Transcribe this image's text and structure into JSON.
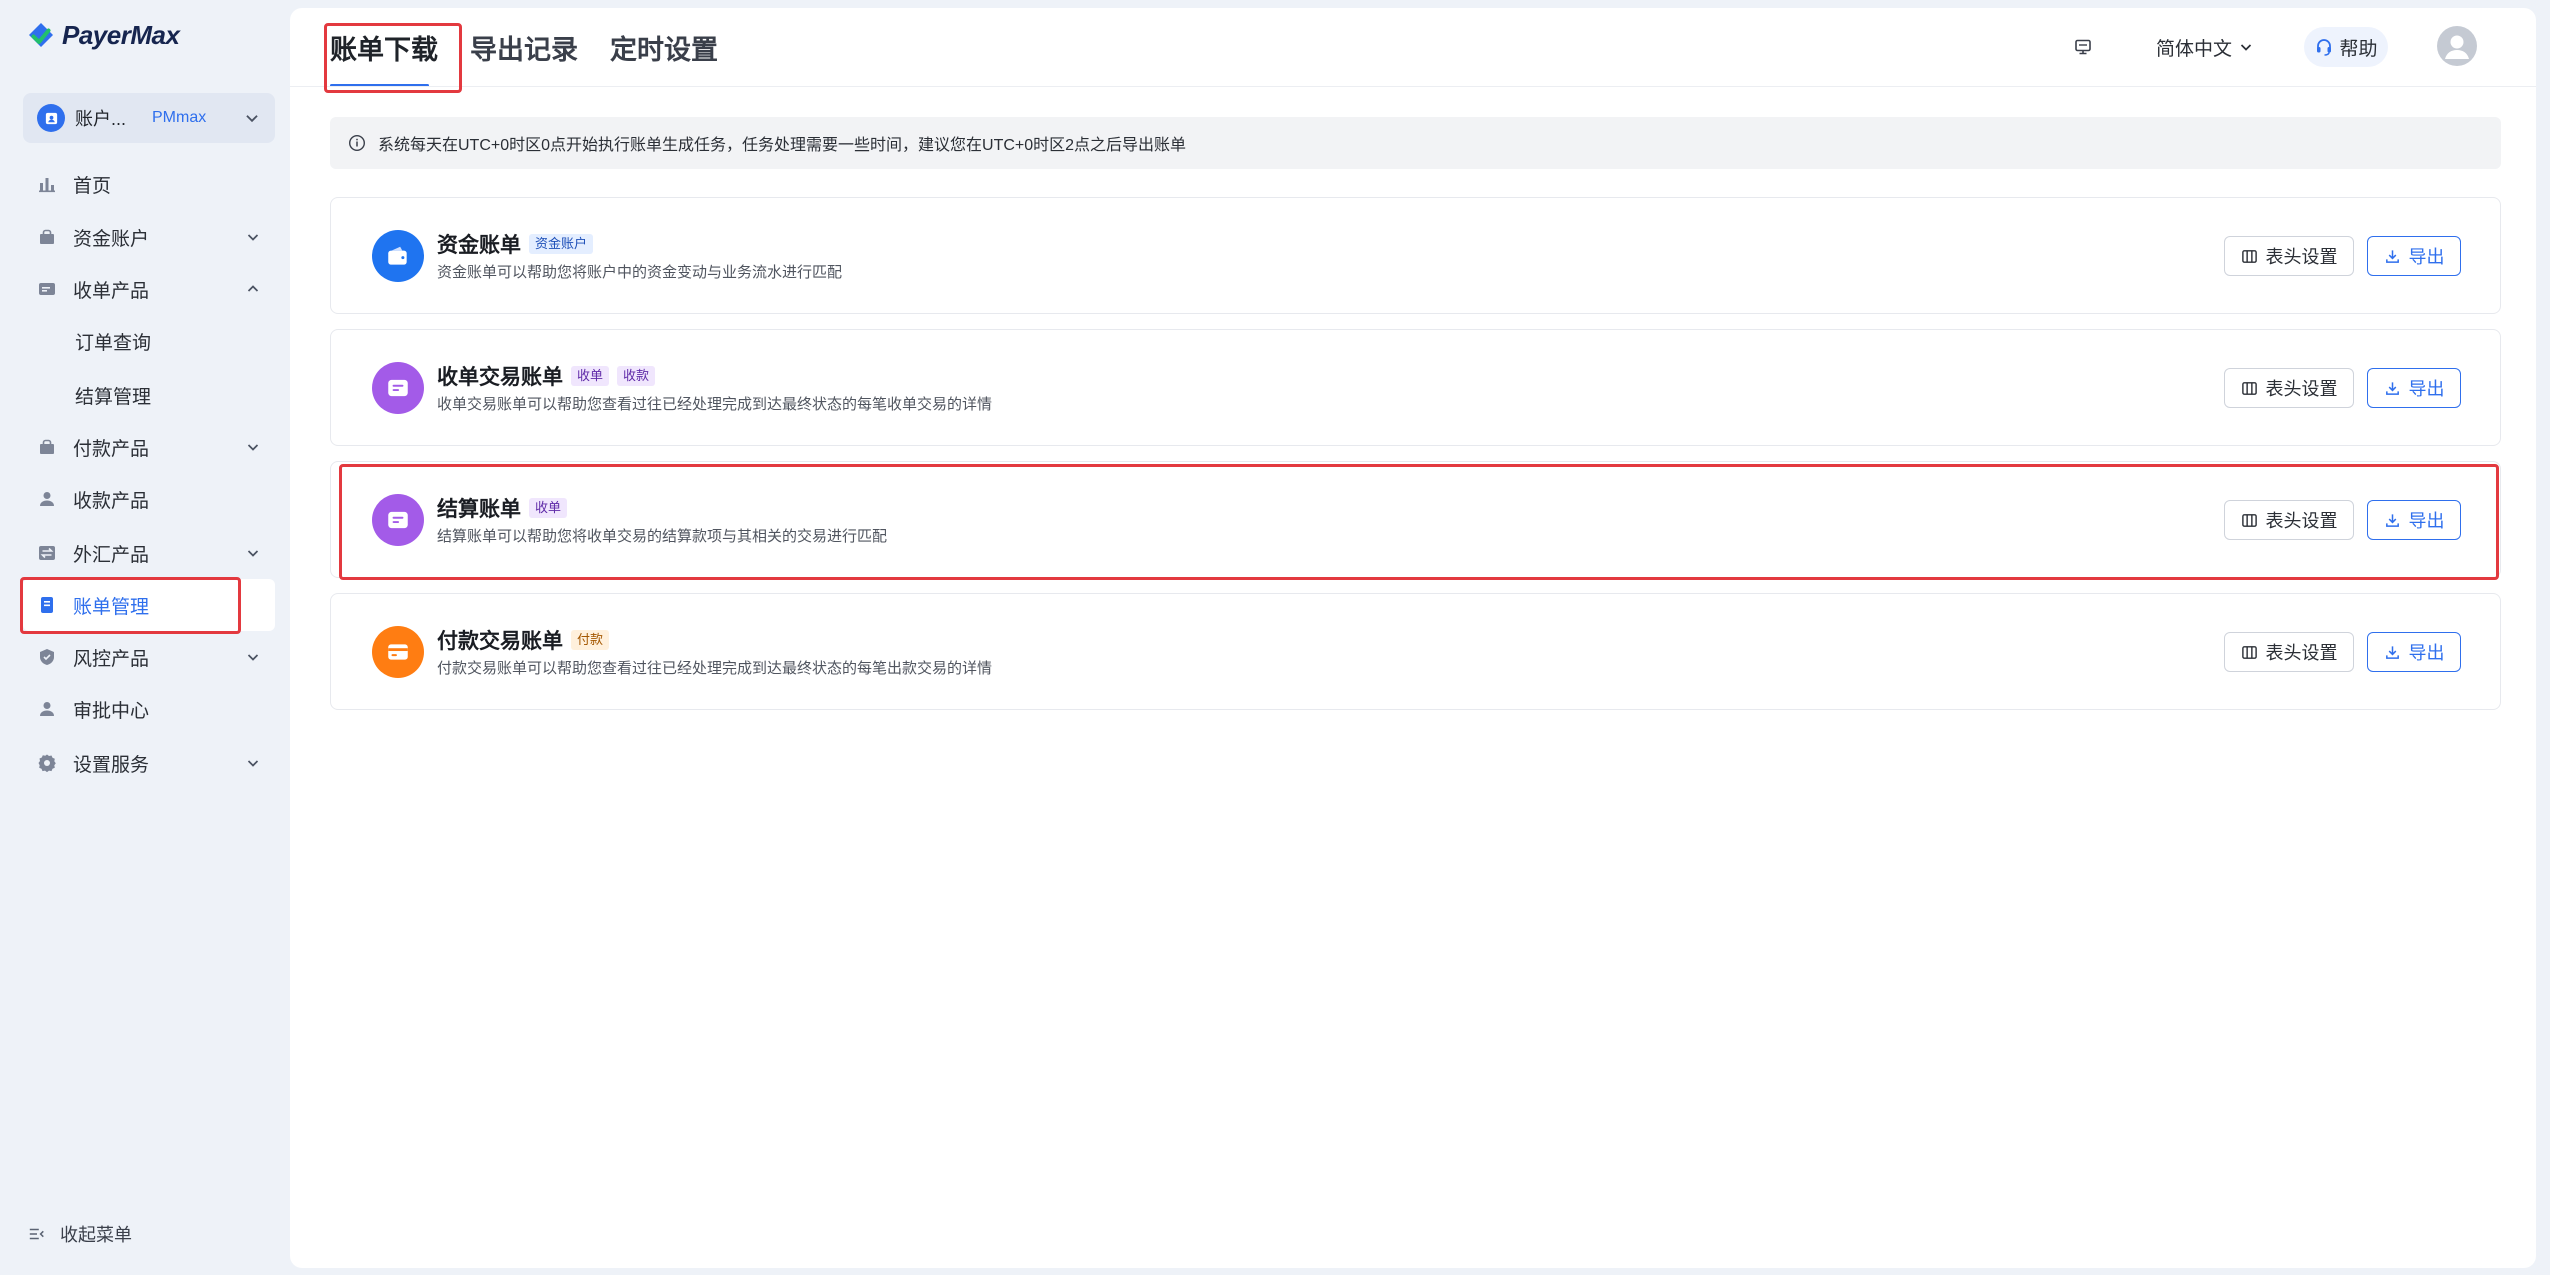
{
  "app": {
    "logo_text": "PayerMax"
  },
  "colors": {
    "accent": "#2f6fed",
    "annotation": "#e3393f",
    "sidebar_bg": "#eef2f8"
  },
  "sidebar": {
    "account": {
      "label": "账户...",
      "tag": "PMmax"
    },
    "items": [
      {
        "label": "首页",
        "icon": "bar-chart-icon"
      },
      {
        "label": "资金账户",
        "icon": "wallet-icon",
        "has_submenu": true,
        "expanded": false
      },
      {
        "label": "收单产品",
        "icon": "card-icon",
        "has_submenu": true,
        "expanded": true
      },
      {
        "label": "订单查询",
        "sub": true
      },
      {
        "label": "结算管理",
        "sub": true
      },
      {
        "label": "付款产品",
        "icon": "wallet-icon",
        "has_submenu": true,
        "expanded": false
      },
      {
        "label": "收款产品",
        "icon": "user-icon"
      },
      {
        "label": "外汇产品",
        "icon": "exchange-icon",
        "has_submenu": true,
        "expanded": false
      },
      {
        "label": "账单管理",
        "icon": "document-icon",
        "active": true,
        "highlighted": true
      },
      {
        "label": "风控产品",
        "icon": "shield-icon",
        "has_submenu": true,
        "expanded": false
      },
      {
        "label": "审批中心",
        "icon": "user-icon"
      },
      {
        "label": "设置服务",
        "icon": "gear-icon",
        "has_submenu": true,
        "expanded": false
      }
    ],
    "collapse_label": "收起菜单"
  },
  "header": {
    "tabs": [
      {
        "label": "账单下载",
        "active": true,
        "highlighted": true
      },
      {
        "label": "导出记录",
        "active": false
      },
      {
        "label": "定时设置",
        "active": false
      }
    ],
    "language": "简体中文",
    "help_label": "帮助"
  },
  "notice": {
    "icon": "info-icon",
    "text": "系统每天在UTC+0时区0点开始执行账单生成任务，任务处理需要一些时间，建议您在UTC+0时区2点之后导出账单"
  },
  "buttons": {
    "column_settings": "表头设置",
    "export": "导出"
  },
  "bills": [
    {
      "title": "资金账单",
      "icon": "wallet-icon",
      "color": "#1f74f0",
      "tags": [
        {
          "label": "资金账户",
          "bg": "#e4eeff",
          "fg": "#1d4fb8"
        }
      ],
      "desc": "资金账单可以帮助您将账户中的资金变动与业务流水进行匹配"
    },
    {
      "title": "收单交易账单",
      "icon": "document-icon",
      "color": "#a35be8",
      "tags": [
        {
          "label": "收单",
          "bg": "#f0e6fd",
          "fg": "#5f2aa8"
        },
        {
          "label": "收款",
          "bg": "#f0e6fd",
          "fg": "#5f2aa8"
        }
      ],
      "desc": "收单交易账单可以帮助您查看过往已经处理完成到达最终状态的每笔收单交易的详情"
    },
    {
      "title": "结算账单",
      "icon": "document-icon",
      "color": "#a35be8",
      "highlighted": true,
      "tags": [
        {
          "label": "收单",
          "bg": "#f0e6fd",
          "fg": "#5f2aa8"
        }
      ],
      "desc": "结算账单可以帮助您将收单交易的结算款项与其相关的交易进行匹配"
    },
    {
      "title": "付款交易账单",
      "icon": "credit-card-icon",
      "color": "#ff7d12",
      "tags": [
        {
          "label": "付款",
          "bg": "#fff0dc",
          "fg": "#a35600"
        }
      ],
      "desc": "付款交易账单可以帮助您查看过往已经处理完成到达最终状态的每笔出款交易的详情"
    }
  ]
}
